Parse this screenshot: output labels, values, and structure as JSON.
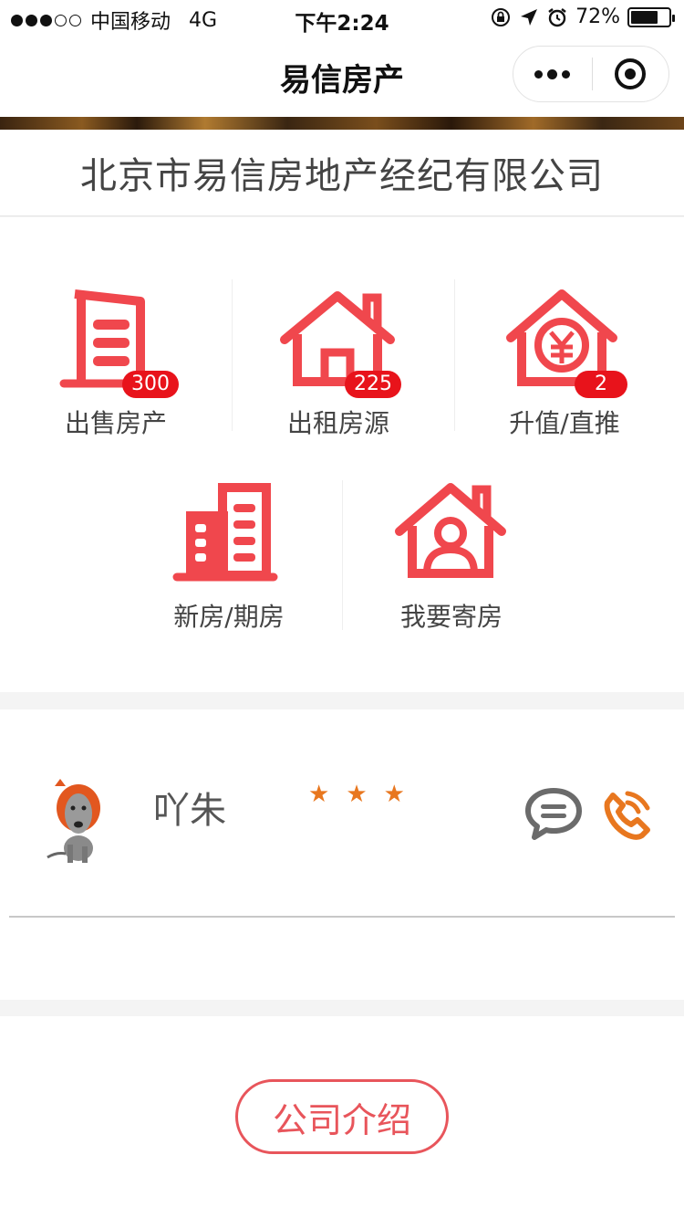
{
  "status_bar": {
    "carrier": "中国移动",
    "network": "4G",
    "time": "下午2:24",
    "battery_text": "72%",
    "battery_level": 0.72
  },
  "nav": {
    "title": "易信房产"
  },
  "company": {
    "name": "北京市易信房地产经纪有限公司"
  },
  "menu": {
    "items": [
      {
        "label": "出售房产",
        "badge": "300",
        "icon": "building-icon"
      },
      {
        "label": "出租房源",
        "badge": "225",
        "icon": "house-icon"
      },
      {
        "label": "升值/直推",
        "badge": "2",
        "icon": "yuan-house-icon"
      },
      {
        "label": "新房/期房",
        "badge": "",
        "icon": "apartments-icon"
      },
      {
        "label": "我要寄房",
        "badge": "",
        "icon": "person-house-icon"
      }
    ]
  },
  "agent": {
    "name": "吖朱",
    "rating": 3,
    "star_glyph": "★"
  },
  "bottom": {
    "intro_label": "公司介绍"
  },
  "colors": {
    "accent_red": "#f0474d",
    "badge_red": "#e8131b",
    "star_orange": "#e8771f",
    "phone_orange": "#e8771f",
    "message_gray": "#6b6b6b"
  }
}
